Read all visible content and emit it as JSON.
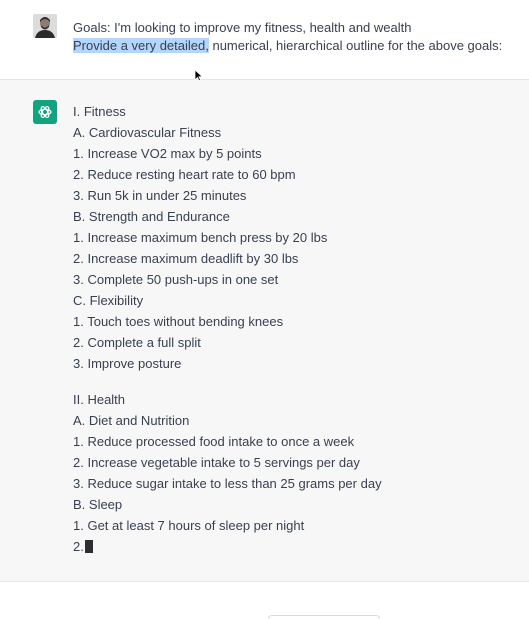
{
  "user_message": {
    "line1": "Goals: I'm looking to improve my fitness, health and wealth",
    "line2_highlighted": "Provide a very detailed,",
    "line2_rest": " numerical, hierarchical outline for the above goals:"
  },
  "assistant_message": {
    "lines": [
      "I. Fitness",
      "A. Cardiovascular Fitness",
      "1. Increase VO2 max by 5 points",
      "2. Reduce resting heart rate to 60 bpm",
      "3. Run 5k in under 25 minutes",
      "B. Strength and Endurance",
      "1. Increase maximum bench press by 20 lbs",
      "2. Increase maximum deadlift by 30 lbs",
      "3. Complete 50 push-ups in one set",
      "C. Flexibility",
      "1. Touch toes without bending knees",
      "2. Complete a full split",
      "3. Improve posture",
      "",
      "II. Health",
      "A. Diet and Nutrition",
      "1. Reduce processed food intake to once a week",
      "2. Increase vegetable intake to 5 servings per day",
      "3. Reduce sugar intake to less than 25 grams per day",
      "B. Sleep",
      "1. Get at least 7 hours of sleep per night",
      "2."
    ],
    "streaming": true
  },
  "icons": {
    "user_avatar": "user-avatar-icon",
    "assistant_avatar": "chatgpt-logo-icon",
    "mouse_cursor": "mouse-pointer-icon"
  },
  "colors": {
    "assistant_bg": "#f7f7f8",
    "brand_green": "#10a37f",
    "selection": "#b4d5fe"
  }
}
